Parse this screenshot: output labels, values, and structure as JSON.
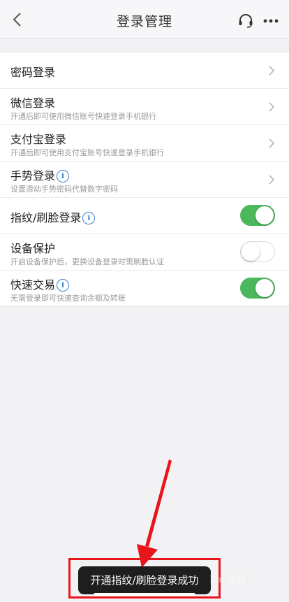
{
  "header": {
    "title": "登录管理"
  },
  "settings": {
    "items": [
      {
        "title": "密码登录",
        "subtitle": ""
      },
      {
        "title": "微信登录",
        "subtitle": "开通后即可使用微信账号快速登录手机银行"
      },
      {
        "title": "支付宝登录",
        "subtitle": "开通后即可使用支付宝账号快速登录手机银行"
      },
      {
        "title": "手势登录",
        "subtitle": "设置滑动手势密码代替数字密码"
      },
      {
        "title": "指纹/刷脸登录",
        "subtitle": "",
        "enabled": true
      },
      {
        "title": "设备保护",
        "subtitle": "开启设备保护后，更换设备登录时需刷脸认证",
        "enabled": false
      },
      {
        "title": "快速交易",
        "subtitle": "无需登录即可快速查询余额及转账",
        "enabled": true
      }
    ]
  },
  "toast": {
    "message": "开通指纹/刷脸登录成功"
  },
  "watermark": {
    "text": "Bai 经验"
  },
  "colors": {
    "toggle_on": "#4cb85c",
    "info_blue": "#3b7fd6",
    "annotation_red": "#e8161c"
  },
  "icons": {
    "back": "chevron-left-icon",
    "support": "headset-icon",
    "more": "more-dots-icon",
    "row_arrow": "chevron-right-icon",
    "info": "info-icon"
  }
}
